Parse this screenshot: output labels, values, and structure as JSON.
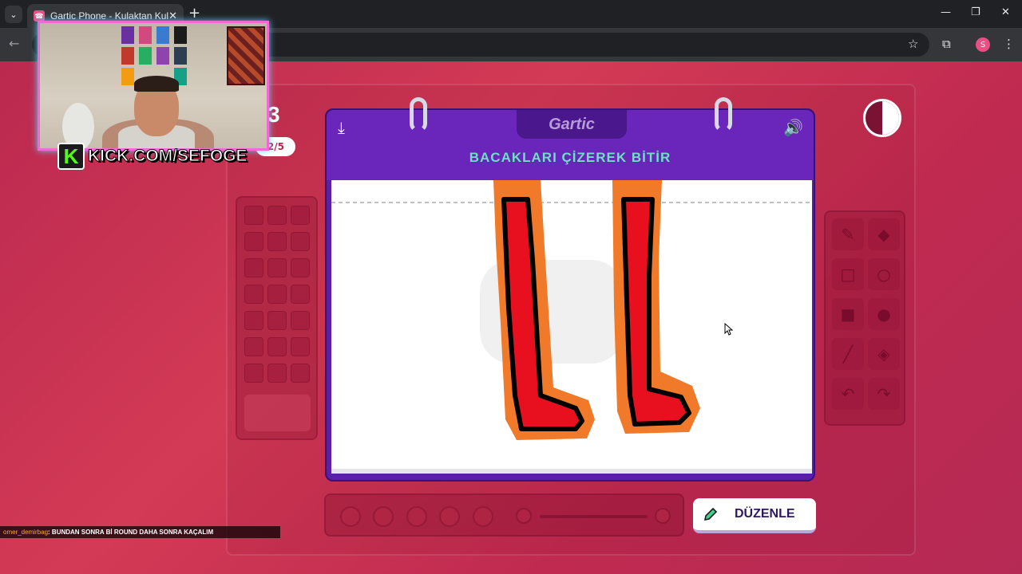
{
  "browser": {
    "tab_title": "Gartic Phone - Kulaktan Kulağa",
    "favicon": "☎",
    "close": "✕",
    "new_tab": "+",
    "profile_initial": "S"
  },
  "game": {
    "counter": "3",
    "round": "2/5",
    "logo": "Gartic",
    "prompt": "BACAKLARI ÇİZEREK BİTİR",
    "done_label": "DÜZENLE",
    "colors": {
      "header": "#6a25bb",
      "prompt": "#6ee0c4",
      "leg_fill": "#e8101e",
      "leg_outline": "#000000",
      "leg_border": "#f07a2a"
    }
  },
  "overlay": {
    "kick_logo": "K",
    "kick_text": "KICK.COM/SEFOGE",
    "chat_user": "omer_demirbag",
    "chat_message": ": BUNDAN SONRA Bİ ROUND DAHA SONRA KAÇALIM"
  }
}
